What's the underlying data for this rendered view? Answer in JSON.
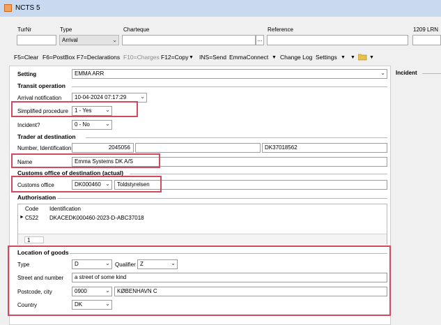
{
  "window": {
    "title": "NCTS 5"
  },
  "filters": {
    "turnr_label": "TurNr",
    "type_label": "Type",
    "type_value": "Arrival",
    "charteque_label": "Charteque",
    "reference_label": "Reference",
    "lrn_label": "1209 LRN"
  },
  "toolbar": {
    "clear": "F5=Clear",
    "postbox": "F6=PostBox",
    "declarations": "F7=Declarations",
    "charges": "F10=Charges",
    "copy": "F12=Copy",
    "send": "INS=Send",
    "emmaconnect": "EmmaConnect",
    "changelog": "Change Log",
    "settings": "Settings"
  },
  "form": {
    "setting_label": "Setting",
    "setting_value": "EMMA ARR",
    "transit_section": "Transit operation",
    "arrival_label": "Arrival notification",
    "arrival_value": "10-04-2024 07:17:29",
    "simplified_label": "Simplified procedure",
    "simplified_value": "1 - Yes",
    "incident_label": "Incident?",
    "incident_value": "0 - No",
    "trader_section": "Trader at destination",
    "number_label": "Number, Identification",
    "number_value": "2045056",
    "id_value": "DK37018562",
    "name_label": "Name",
    "name_value": "Emma Systems DK A/S",
    "customs_section": "Customs office of destination (actual)",
    "customs_label": "Customs office",
    "customs_code": "DK000460",
    "customs_name": "Toldstyrelsen",
    "auth_section": "Authorisation",
    "auth_col_code": "Code",
    "auth_col_ident": "Identification",
    "auth_rows": [
      {
        "code": "C522",
        "ident": "DKACEDK000460-2023-D-ABC37018"
      }
    ],
    "auth_page": "1",
    "location_section": "Location of goods",
    "type_label": "Type",
    "type_value": "D",
    "qualifier_label": "Qualifier",
    "qualifier_value": "Z",
    "street_label": "Street and number",
    "street_value": "a street of some kind",
    "postcode_label": "Postcode, city",
    "postcode_value": "0900",
    "city_value": "KØBENHAVN C",
    "country_label": "Country",
    "country_value": "DK"
  },
  "side": {
    "incident_title": "Incident"
  },
  "colors": {
    "highlight": "#d2495d",
    "titlebar": "#c9daf0"
  }
}
